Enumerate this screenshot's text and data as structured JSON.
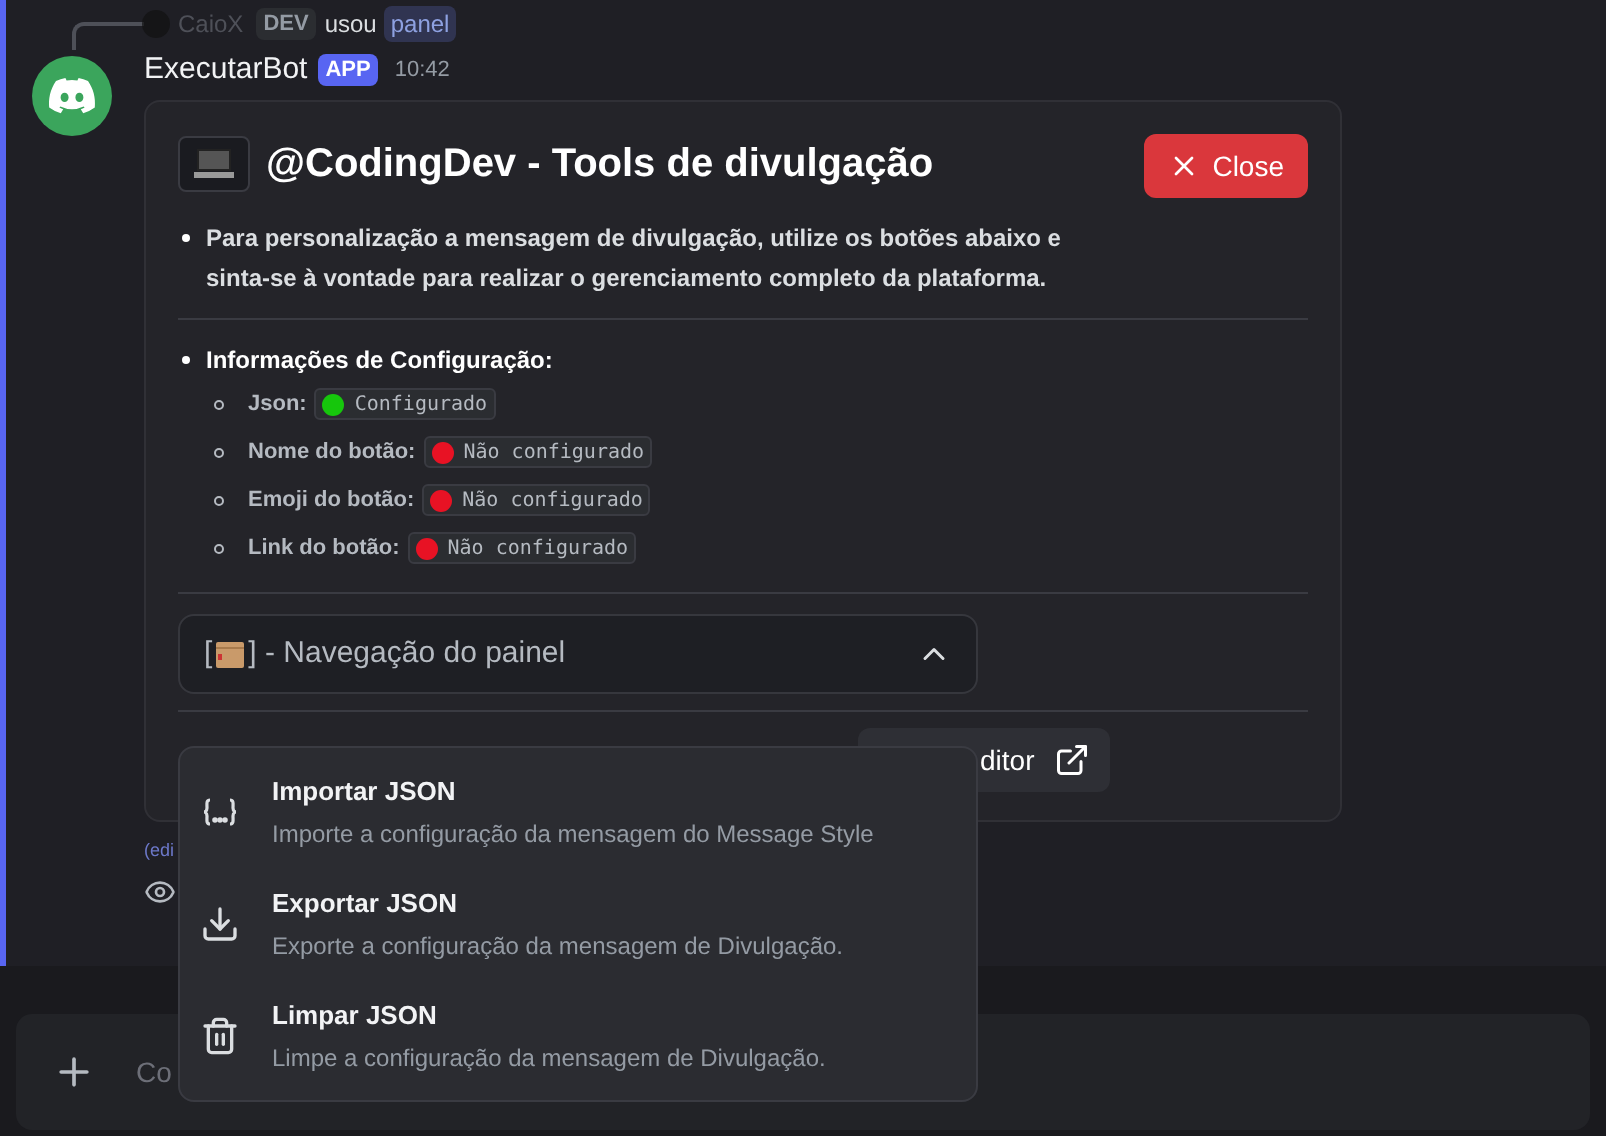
{
  "reply": {
    "author": "CaioX",
    "tag": "DEV",
    "verb": "usou",
    "command": "panel"
  },
  "message": {
    "author": "ExecutarBot",
    "badge": "APP",
    "time": "10:42"
  },
  "embed": {
    "title": "@CodingDev - Tools de divulgação",
    "close_button": "Close",
    "description": "Para personalização a mensagem de divulgação, utilize os botões abaixo e sinta-se à vontade para realizar o gerenciamento completo da plataforma.",
    "section_title": "Informações de Configuração:",
    "config_items": [
      {
        "label": "Json:",
        "status": "Configurado",
        "color": "#16c60c"
      },
      {
        "label": "Nome do botão:",
        "status": "Não configurado",
        "color": "#e81224"
      },
      {
        "label": "Emoji do botão:",
        "status": "Não configurado",
        "color": "#e81224"
      },
      {
        "label": "Link do botão:",
        "status": "Não configurado",
        "color": "#e81224"
      }
    ],
    "select": {
      "prefix": "[",
      "label": "] - Navegação do painel",
      "expanded": true
    },
    "editor_button": "ditor"
  },
  "edited": "(edi",
  "composer": {
    "placeholder": "Co"
  },
  "menu": [
    {
      "kind": "import",
      "title": "Importar JSON",
      "description": "Importe a configuração da mensagem do Message Style"
    },
    {
      "kind": "export",
      "title": "Exportar JSON",
      "description": "Exporte a configuração da mensagem de Divulgação."
    },
    {
      "kind": "clear",
      "title": "Limpar JSON",
      "description": "Limpe a configuração da mensagem de Divulgação."
    }
  ]
}
